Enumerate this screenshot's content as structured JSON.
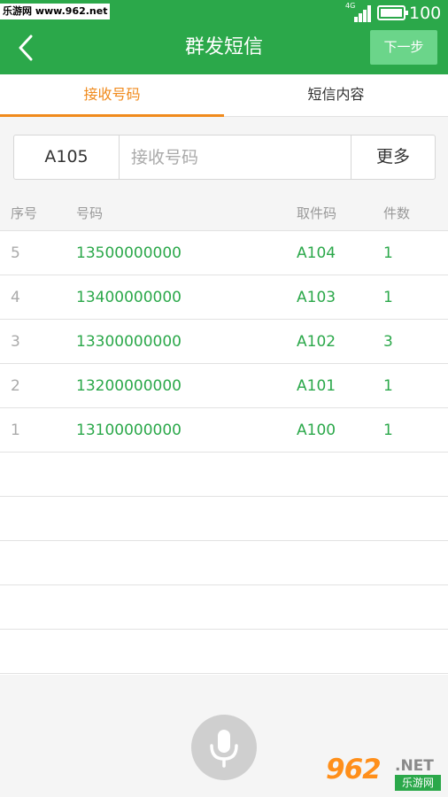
{
  "status_bar": {
    "watermark": "乐游网 www.962.net",
    "network": "4G",
    "battery_level": 100,
    "battery_text": "100"
  },
  "header": {
    "title": "群发短信",
    "next_label": "下一步"
  },
  "tabs": [
    {
      "label": "接收号码",
      "active": true
    },
    {
      "label": "短信内容",
      "active": false
    }
  ],
  "input_row": {
    "code": "A105",
    "phone_placeholder": "接收号码",
    "more_label": "更多"
  },
  "table": {
    "headers": {
      "seq": "序号",
      "phone": "号码",
      "code": "取件码",
      "qty": "件数"
    },
    "rows": [
      {
        "seq": "5",
        "phone": "13500000000",
        "code": "A104",
        "qty": "1"
      },
      {
        "seq": "4",
        "phone": "13400000000",
        "code": "A103",
        "qty": "1"
      },
      {
        "seq": "3",
        "phone": "13300000000",
        "code": "A102",
        "qty": "3"
      },
      {
        "seq": "2",
        "phone": "13200000000",
        "code": "A101",
        "qty": "1"
      },
      {
        "seq": "1",
        "phone": "13100000000",
        "code": "A100",
        "qty": "1"
      }
    ]
  },
  "footer_logo": {
    "big": "962",
    "ext": ".NET",
    "sub": "乐游网"
  },
  "colors": {
    "brand_green": "#2ba84a",
    "accent_orange": "#f08a1c",
    "next_button": "#6bd58a"
  },
  "icons": {
    "back": "chevron-left-icon",
    "mic": "microphone-icon",
    "signal": "signal-icon",
    "battery": "battery-icon"
  }
}
